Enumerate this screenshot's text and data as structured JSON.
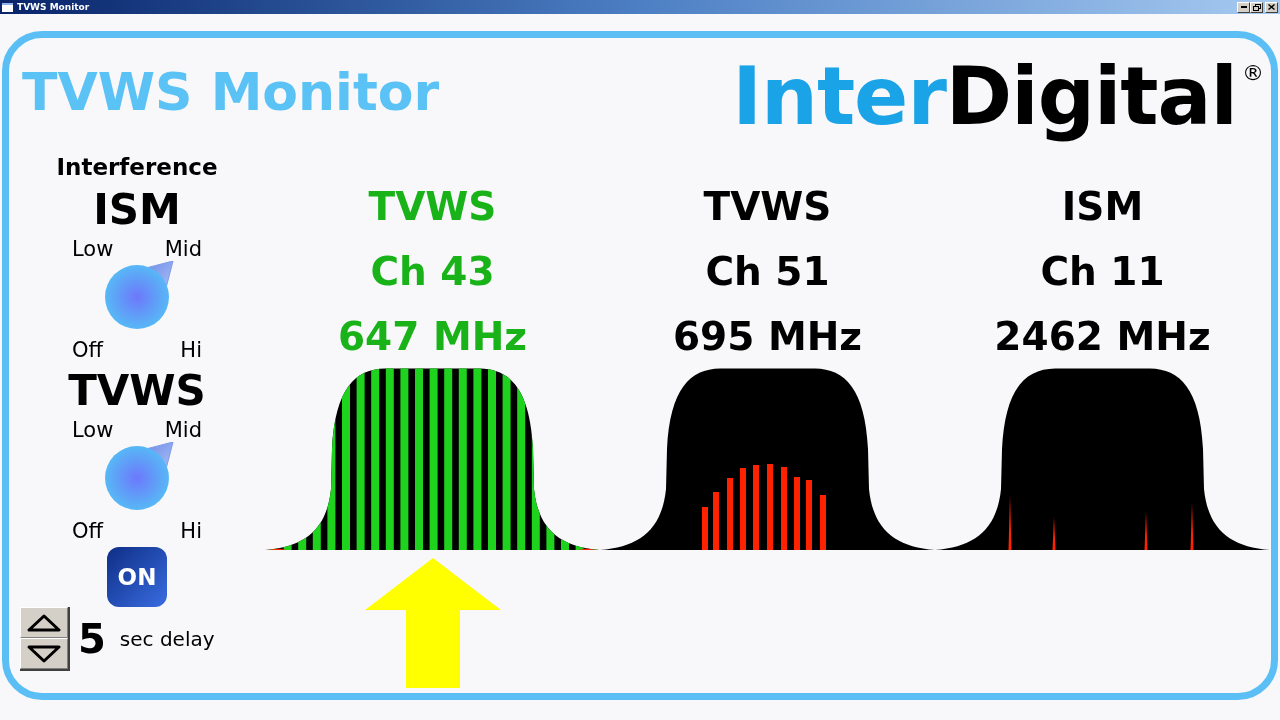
{
  "window": {
    "title": "TVWS Monitor"
  },
  "header": {
    "title": "TVWS Monitor",
    "logo": {
      "parts": [
        {
          "text": "Inter",
          "color": "#1ba3e8"
        },
        {
          "text": "Digital",
          "color": "#000000"
        }
      ],
      "mark": "®"
    }
  },
  "controls": {
    "heading": "Interference",
    "dials": [
      {
        "name": "ISM",
        "options": [
          {
            "label": "Low",
            "selected": false
          },
          {
            "label": "Mid",
            "selected": true
          },
          {
            "label": "Off",
            "selected": false
          },
          {
            "label": "Hi",
            "selected": false
          }
        ]
      },
      {
        "name": "TVWS",
        "options": [
          {
            "label": "Low",
            "selected": false
          },
          {
            "label": "Mid",
            "selected": true
          },
          {
            "label": "Off",
            "selected": false
          },
          {
            "label": "Hi",
            "selected": false
          }
        ]
      }
    ],
    "power": {
      "label": "ON",
      "on": true
    },
    "delay": {
      "value": "5",
      "unit": "sec delay"
    }
  },
  "channels": [
    {
      "band": "TVWS",
      "channel": "Ch 43",
      "frequency": "647 MHz",
      "selected": true,
      "kind": "clear"
    },
    {
      "band": "TVWS",
      "channel": "Ch 51",
      "frequency": "695 MHz",
      "selected": false,
      "kind": "wideband"
    },
    {
      "band": "ISM",
      "channel": "Ch 11",
      "frequency": "2462 MHz",
      "selected": false,
      "kind": "narrowband"
    }
  ]
}
